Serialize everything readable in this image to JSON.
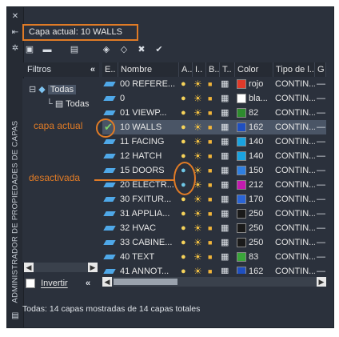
{
  "current_layer": "Capa actual: 10 WALLS",
  "side_title": "ADMINISTRADOR DE PROPIEDADES DE CAPAS",
  "filters": {
    "header": "Filtros",
    "collapse": "«",
    "tree": [
      {
        "label": "Todas",
        "selected": true
      },
      {
        "label": "Todas",
        "selected": false
      }
    ],
    "invert_label": "Invertir",
    "invert_checked": false
  },
  "columns": [
    "E..",
    "Nombre",
    "A..",
    "I..",
    "B..",
    "T..",
    "Color",
    "Tipo de l..",
    "G"
  ],
  "layers": [
    {
      "name": "00 REFERE...",
      "color_name": "rojo",
      "color": "#e03a2a",
      "ltype": "CONTIN...",
      "on": true,
      "current": false
    },
    {
      "name": "0",
      "color_name": "bla...",
      "color": "#ffffff",
      "ltype": "CONTIN...",
      "on": true,
      "current": false
    },
    {
      "name": "01 VIEWP...",
      "color_name": "82",
      "color": "#2e8b2e",
      "ltype": "CONTIN...",
      "on": true,
      "current": false
    },
    {
      "name": "10 WALLS",
      "color_name": "162",
      "color": "#1f4fbf",
      "ltype": "CONTIN...",
      "on": true,
      "current": true
    },
    {
      "name": "11 FACING",
      "color_name": "140",
      "color": "#1aa3e0",
      "ltype": "CONTIN...",
      "on": true,
      "current": false
    },
    {
      "name": "12 HATCH",
      "color_name": "140",
      "color": "#1aa3e0",
      "ltype": "CONTIN...",
      "on": true,
      "current": false
    },
    {
      "name": "15 DOORS",
      "color_name": "150",
      "color": "#2f7fe0",
      "ltype": "CONTIN...",
      "on": false,
      "current": false
    },
    {
      "name": "20 ELECTR...",
      "color_name": "212",
      "color": "#c21bb0",
      "ltype": "CONTIN...",
      "on": false,
      "current": false
    },
    {
      "name": "30 FXITUR...",
      "color_name": "170",
      "color": "#2a64d6",
      "ltype": "CONTIN...",
      "on": true,
      "current": false
    },
    {
      "name": "31 APPLIA...",
      "color_name": "250",
      "color": "#1a1a1a",
      "ltype": "CONTIN...",
      "on": true,
      "current": false
    },
    {
      "name": "32 HVAC",
      "color_name": "250",
      "color": "#1a1a1a",
      "ltype": "CONTIN...",
      "on": true,
      "current": false
    },
    {
      "name": "33 CABINE...",
      "color_name": "250",
      "color": "#1a1a1a",
      "ltype": "CONTIN...",
      "on": true,
      "current": false
    },
    {
      "name": "40 TEXT",
      "color_name": "83",
      "color": "#3aa53a",
      "ltype": "CONTIN...",
      "on": true,
      "current": false
    },
    {
      "name": "41 ANNOT...",
      "color_name": "162",
      "color": "#1f4fbf",
      "ltype": "CONTIN...",
      "on": true,
      "current": false
    }
  ],
  "status": "Todas: 14 capas mostradas de 14 capas totales",
  "annotations": {
    "current_layer_label": "capa actual",
    "deactivated_label": "desactivada"
  },
  "accent": "#e07b26"
}
